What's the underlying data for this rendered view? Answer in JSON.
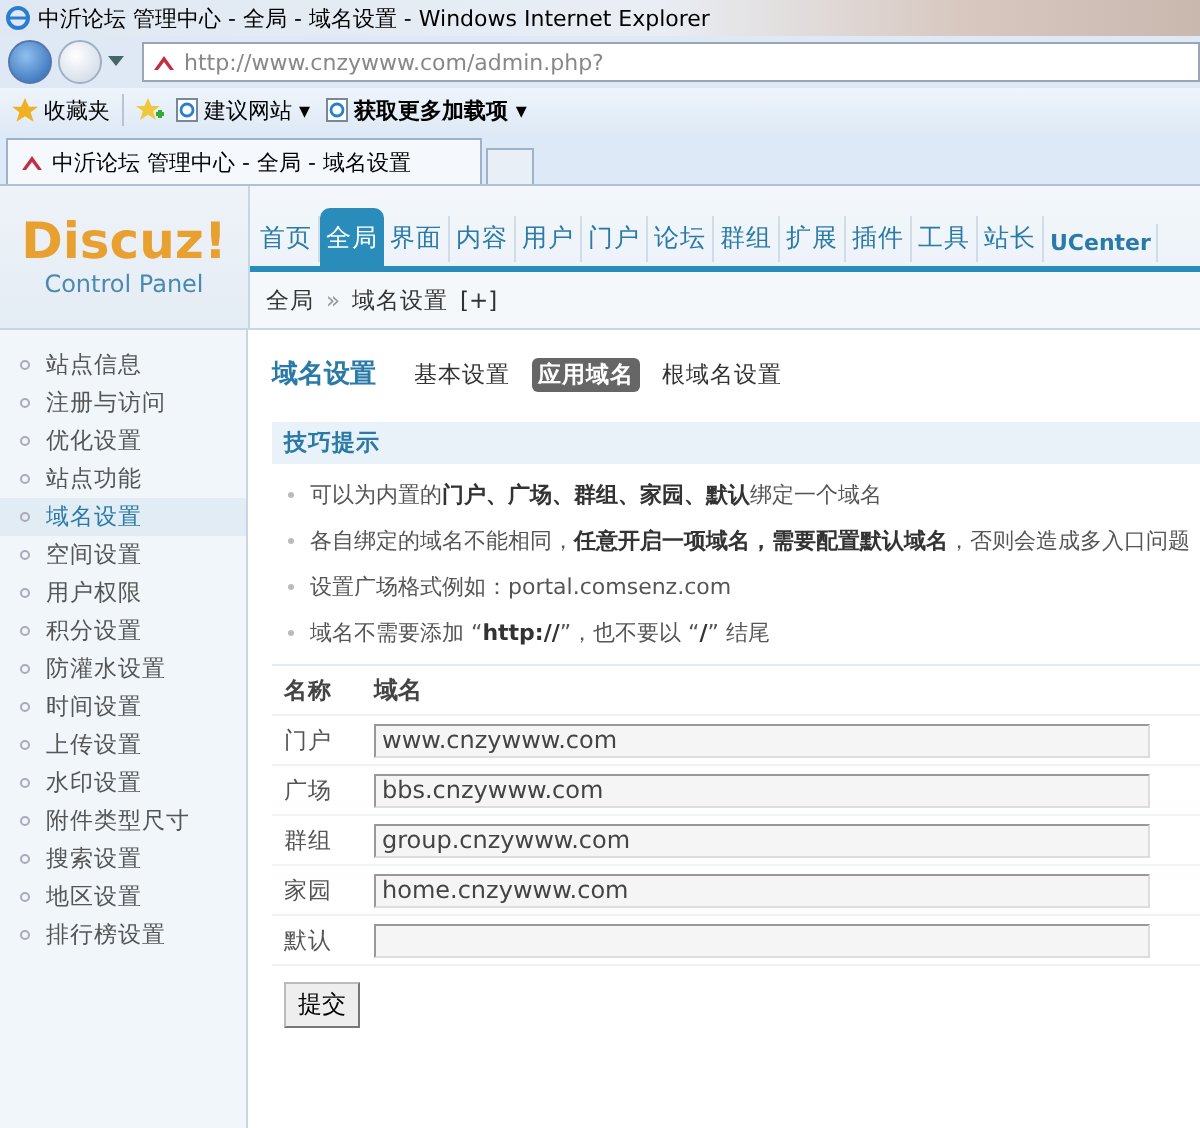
{
  "browser": {
    "title": "中沂论坛 管理中心 - 全局 - 域名设置 - Windows Internet Explorer",
    "address": "http://www.cnzywww.com/admin.php?",
    "favorites_label": "收藏夹",
    "favorites_links": [
      {
        "label": "建议网站 ▾",
        "bold": false
      },
      {
        "label": "获取更多加载项 ▾",
        "bold": true
      }
    ],
    "tab": {
      "title": "中沂论坛 管理中心 - 全局 - 域名设置"
    }
  },
  "header": {
    "logo": "Discuz!",
    "subtitle": "Control Panel",
    "nav": [
      {
        "label": "首页",
        "selected": false
      },
      {
        "label": "全局",
        "selected": true
      },
      {
        "label": "界面",
        "selected": false
      },
      {
        "label": "内容",
        "selected": false
      },
      {
        "label": "用户",
        "selected": false
      },
      {
        "label": "门户",
        "selected": false
      },
      {
        "label": "论坛",
        "selected": false
      },
      {
        "label": "群组",
        "selected": false
      },
      {
        "label": "扩展",
        "selected": false
      },
      {
        "label": "插件",
        "selected": false
      },
      {
        "label": "工具",
        "selected": false
      },
      {
        "label": "站长",
        "selected": false
      },
      {
        "label": "UCenter",
        "selected": false
      }
    ]
  },
  "breadcrumb": {
    "items": [
      "全局",
      "域名设置"
    ],
    "separator": "»",
    "add": "[+]"
  },
  "sidebar": {
    "items": [
      {
        "label": "站点信息",
        "selected": false
      },
      {
        "label": "注册与访问",
        "selected": false
      },
      {
        "label": "优化设置",
        "selected": false
      },
      {
        "label": "站点功能",
        "selected": false
      },
      {
        "label": "域名设置",
        "selected": true
      },
      {
        "label": "空间设置",
        "selected": false
      },
      {
        "label": "用户权限",
        "selected": false
      },
      {
        "label": "积分设置",
        "selected": false
      },
      {
        "label": "防灌水设置",
        "selected": false
      },
      {
        "label": "时间设置",
        "selected": false
      },
      {
        "label": "上传设置",
        "selected": false
      },
      {
        "label": "水印设置",
        "selected": false
      },
      {
        "label": "附件类型尺寸",
        "selected": false
      },
      {
        "label": "搜索设置",
        "selected": false
      },
      {
        "label": "地区设置",
        "selected": false
      },
      {
        "label": "排行榜设置",
        "selected": false
      }
    ]
  },
  "main": {
    "title": "域名设置",
    "subtabs": [
      {
        "label": "基本设置",
        "selected": false
      },
      {
        "label": "应用域名",
        "selected": true
      },
      {
        "label": "根域名设置",
        "selected": false
      }
    ],
    "tips": {
      "title": "技巧提示",
      "items": [
        "可以为内置的**门户、广场、群组、家园、默认**绑定一个域名",
        "各自绑定的域名不能相同，**任意开启一项域名，需要配置默认域名**，否则会造成多入口问题",
        "设置广场格式例如：portal.comsenz.com",
        "域名不需要添加 “**http://**”，也不要以 “**/**” 结尾"
      ]
    },
    "table": {
      "columns": [
        "名称",
        "域名"
      ],
      "rows": [
        {
          "name": "门户",
          "value": "www.cnzywww.com"
        },
        {
          "name": "广场",
          "value": "bbs.cnzywww.com"
        },
        {
          "name": "群组",
          "value": "group.cnzywww.com"
        },
        {
          "name": "家园",
          "value": "home.cnzywww.com"
        },
        {
          "name": "默认"
        }
      ]
    },
    "submit": "提交"
  }
}
